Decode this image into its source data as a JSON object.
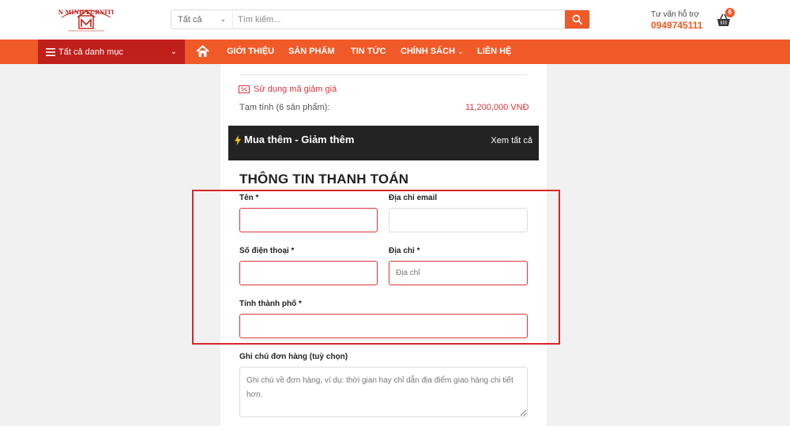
{
  "header": {
    "logo_text": "TIẾN MINH FURNITURE",
    "search": {
      "category": "Tất cả",
      "placeholder": "Tìm kiếm..."
    },
    "support_label": "Tư vấn hỗ trợ",
    "support_phone": "0949745111",
    "cart_count": "6"
  },
  "nav": {
    "category_label": "Tất cả danh mục",
    "items": [
      "GIỚI THIỆU",
      "SẢN PHẨM",
      "TIN TỨC",
      "CHÍNH SÁCH",
      "LIÊN HỆ"
    ]
  },
  "checkout": {
    "coupon_label": "Sử dụng mã giảm giá",
    "subtotal_label": "Tạm tính (6 sản phẩm):",
    "subtotal_value": "11,200,000 VNĐ",
    "promo_title": "Mua thêm - Giảm thêm",
    "promo_link": "Xem tất cả",
    "section_title": "THÔNG TIN THANH TOÁN",
    "fields": {
      "name_label": "Tên *",
      "email_label": "Địa chỉ email",
      "phone_label": "Số điện thoại *",
      "address_label": "Địa chỉ *",
      "address_placeholder": "Địa chỉ",
      "city_label": "Tỉnh thành phố *",
      "note_label": "Ghi chú đơn hàng (tuỳ chọn)",
      "note_placeholder": "Ghi chú về đơn hàng, ví dụ: thời gian hay chỉ dẫn địa điểm giao hàng chi tiết hơn."
    }
  },
  "colors": {
    "accent": "#f05a28",
    "category_bg": "#c0201a",
    "error": "#d9363e"
  }
}
